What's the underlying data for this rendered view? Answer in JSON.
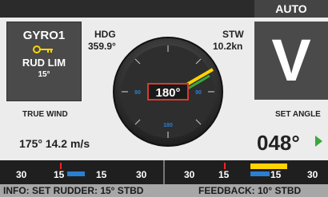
{
  "header": {
    "mode": "AUTO"
  },
  "gyro": {
    "title": "GYRO1",
    "key_icon": "key-icon",
    "sub": "RUD LIM",
    "limit": "15°"
  },
  "heading": {
    "label": "HDG",
    "value": "359.9°"
  },
  "speed": {
    "label": "STW",
    "value": "10.2kn"
  },
  "mode_letter": "V",
  "dial": {
    "set_heading": "180°",
    "scale_labels": [
      "90",
      "90",
      "180"
    ]
  },
  "true_wind": {
    "label": "TRUE WIND",
    "value": "175° 14.2 m/s"
  },
  "set_angle": {
    "label": "SET ANGLE",
    "value": "048°"
  },
  "rudder_scale": {
    "labels": [
      "30",
      "15",
      "15",
      "30",
      "30",
      "15",
      "15",
      "30"
    ]
  },
  "info": {
    "left": "INFO: SET RUDDER: 15° STBD",
    "right": "FEEDBACK: 10° STBD"
  },
  "colors": {
    "set_box": "#d83a2c",
    "accent_green": "#3aa83a",
    "needle_yellow": "#ffd400",
    "scale_blue": "#2b7fd1"
  }
}
